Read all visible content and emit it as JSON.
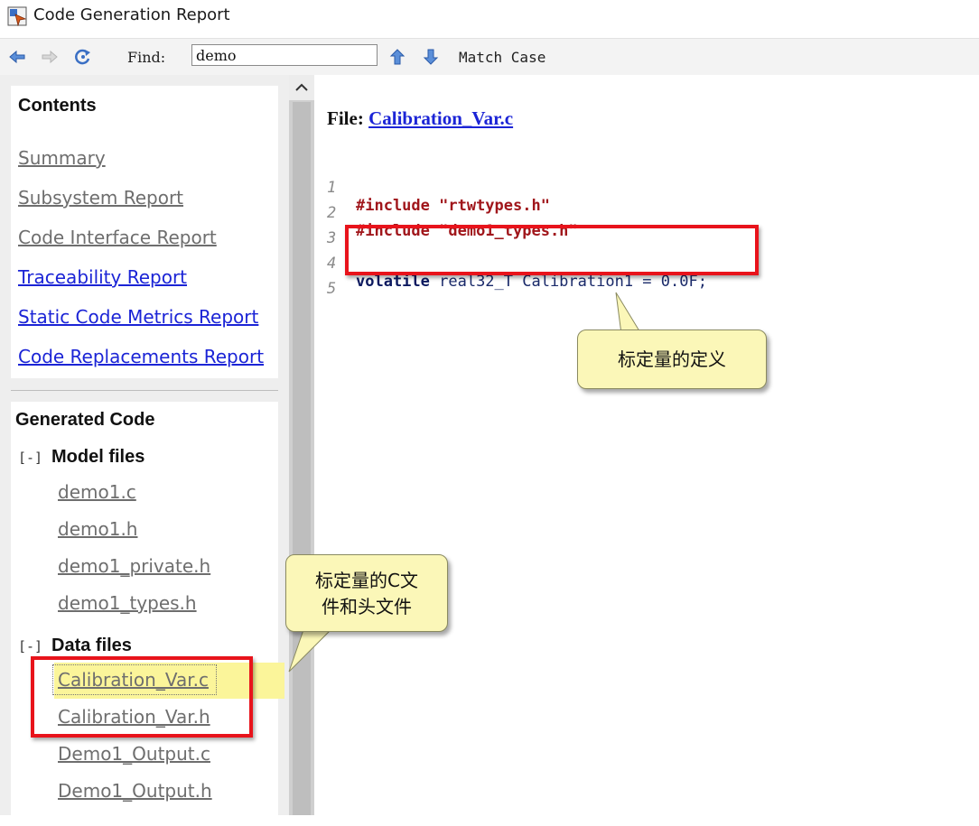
{
  "window": {
    "title": "Code Generation Report"
  },
  "toolbar": {
    "find_label": "Find:",
    "find_value": "demo",
    "match_case_label": "Match Case"
  },
  "sidebar": {
    "contents_title": "Contents",
    "links": [
      {
        "label": "Summary",
        "state": "visited"
      },
      {
        "label": "Subsystem Report",
        "state": "visited"
      },
      {
        "label": "Code Interface Report",
        "state": "visited"
      },
      {
        "label": "Traceability Report",
        "state": "link"
      },
      {
        "label": "Static Code Metrics Report",
        "state": "link"
      },
      {
        "label": "Code Replacements Report",
        "state": "link"
      }
    ],
    "generated_code_title": "Generated Code",
    "groups": [
      {
        "toggle": "[-]",
        "label": "Model files",
        "files": [
          "demo1.c",
          "demo1.h",
          "demo1_private.h",
          "demo1_types.h"
        ]
      },
      {
        "toggle": "[-]",
        "label": "Data files",
        "files": [
          "Calibration_Var.c",
          "Calibration_Var.h",
          "Demo1_Output.c",
          "Demo1_Output.h"
        ]
      }
    ],
    "selected_file": "Calibration_Var.c"
  },
  "main": {
    "file_label": "File:",
    "file_name": "Calibration_Var.c",
    "code_lines": [
      {
        "num": "1",
        "directive": "#include",
        "rest": " \"rtwtypes.h\""
      },
      {
        "num": "2",
        "directive": "#include",
        "rest": " \"demo1_types.h\""
      },
      {
        "num": "3",
        "directive": "",
        "rest": ""
      },
      {
        "num": "4",
        "keyword": "volatile",
        "rest": " real32_T Calibration1 = 0.0F;"
      },
      {
        "num": "5",
        "directive": "",
        "rest": ""
      }
    ]
  },
  "annotations": {
    "callout_definition": "标定量的定义",
    "callout_files": "标定量的C文件和头文件",
    "callout_files_line1": "标定量的C文",
    "callout_files_line2": "件和头文件",
    "highlight_color": "#e8131b",
    "callout_color": "#fbf7b8"
  },
  "colors": {
    "link_blue": "#1b24d6",
    "visited_grey": "#6e6e6e",
    "preprocessor": "#a0161b",
    "keyword": "#0d1a60"
  }
}
